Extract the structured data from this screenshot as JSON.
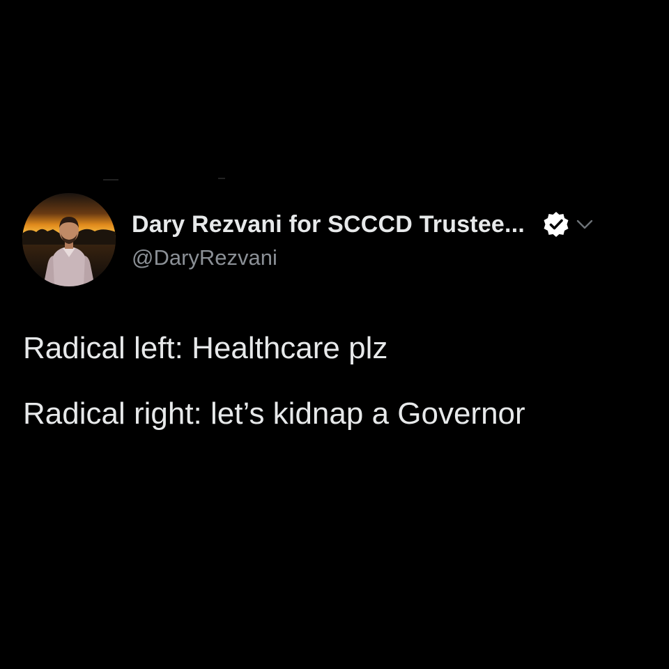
{
  "author": {
    "display_name": "Dary Rezvani for SCCCD Trustee...",
    "handle": "@DaryRezvani",
    "verified": true,
    "avatar_icon": "profile-photo-avatar"
  },
  "tweet": {
    "lines": [
      "Radical left: Healthcare plz",
      "Radical right: let’s kidnap a Governor"
    ]
  },
  "colors": {
    "background": "#000000",
    "text_primary": "#e7e9ea",
    "text_secondary": "#8b9096",
    "verified_badge": "#ffffff"
  },
  "icons": {
    "verified": "verified-badge-icon",
    "menu": "chevron-down-icon"
  }
}
